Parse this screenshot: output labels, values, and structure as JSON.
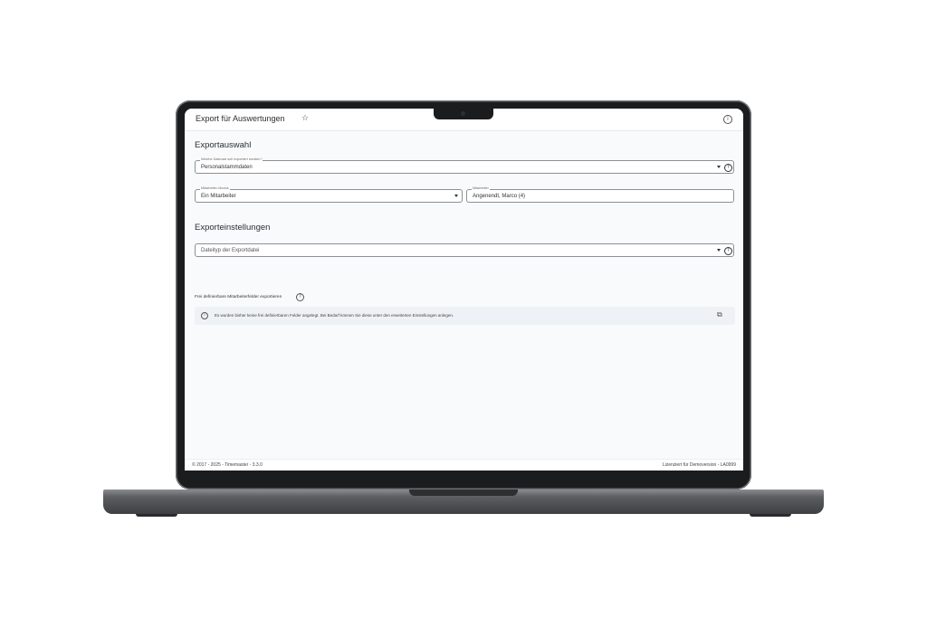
{
  "header": {
    "title": "Export für Auswertungen",
    "favorite_icon": "star-icon",
    "info_icon": "info-icon"
  },
  "export_selection": {
    "section_title": "Exportauswahl",
    "data_type": {
      "label": "Welche Datenart soll exportiert werden?",
      "value": "Personalstammdaten"
    },
    "employee_mode": {
      "label": "Mitarbeiter-Modus",
      "value": "Ein Mitarbeiter"
    },
    "employee": {
      "label": "Mitarbeiter",
      "value": "Angenendt, Marco (4)"
    }
  },
  "export_settings": {
    "section_title": "Exporteinstellungen",
    "file_type": {
      "placeholder": "Dateityp der Exportdatei"
    },
    "custom_fields_label": "Frei definierbare Mitarbeiterfelder exportieren",
    "info_message": "Es wurden bisher keine frei definierbaren Felder angelegt. Bei Bedarf können Sie diese unter den erweiterten Einstellungen anlegen."
  },
  "footer": {
    "copyright": "© 2017 - 2025 - Timemaster - 3.3.0",
    "license": "Lizenziert für Demoversion - LA0999"
  },
  "colors": {
    "laptop_frame": "#1b1c1e",
    "content_background": "#f8fafc",
    "info_box_background": "#eef2f6",
    "field_border": "#8c9196"
  }
}
